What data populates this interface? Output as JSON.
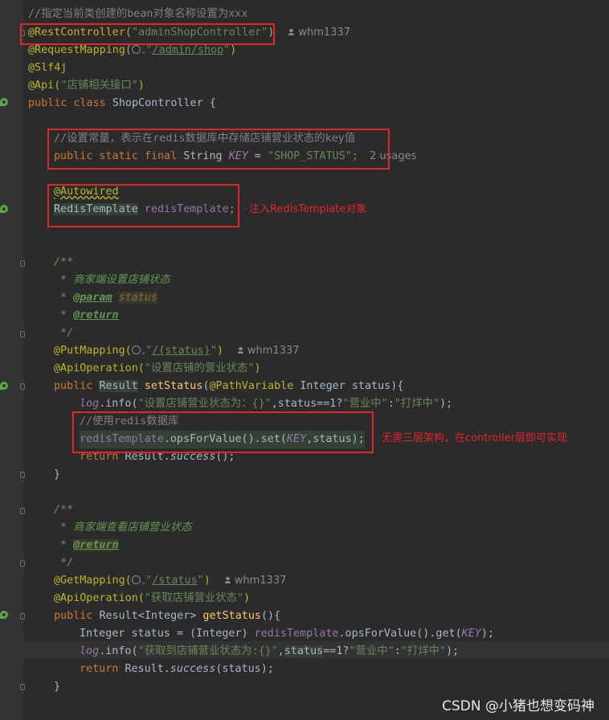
{
  "code": {
    "l1": "//指定当前类创建的bean对象名称设置为xxx",
    "l2_ann": "@RestController(",
    "l2_str": "\"adminShopController\"",
    "l2_end": ")",
    "author": "whm1337",
    "l3_ann": "@RequestMapping(",
    "l3_q1": "\"",
    "l3_path": "/admin/shop",
    "l3_q2": "\"",
    "l3_end": ")",
    "l4": "@Slf4j",
    "l5_ann": "@Api(",
    "l5_str": "\"店铺相关接口\"",
    "l5_end": ")",
    "l6_kw": "public class ",
    "l6_name": "ShopController {",
    "l8": "//设置常量，表示在redis数据库中存储店铺营业状态的key值",
    "l9_kw": "public static final ",
    "l9_type": "String ",
    "l9_field": "KEY",
    "l9_eq": " = ",
    "l9_str": "\"SHOP_STATUS\"",
    "l9_semi": ";",
    "l9_usages": "2 usages",
    "l11": "@Autowired",
    "l12_type": "RedisTemplate",
    "l12_field": " redisTemplate",
    "l12_semi": ";",
    "note1": "注入RedisTemplate对象",
    "l15": "/**",
    "l16": " * 商家端设置店铺状态",
    "l17_star": " * ",
    "l17_tag": "@param",
    "l17_param": "status",
    "l18_star": " * ",
    "l18_tag": "@return",
    "l19": " */",
    "l20_ann": "@PutMapping(",
    "l20_q1": "\"",
    "l20_path": "/{status}",
    "l20_q2": "\"",
    "l20_end": ")",
    "l21_ann": "@ApiOperation(",
    "l21_str": "\"设置店铺的营业状态\"",
    "l21_end": ")",
    "l22_kw": "public ",
    "l22_type": "Result",
    "l22_fn": " setStatus",
    "l22_p1": "(",
    "l22_ann": "@PathVariable",
    "l22_rest": " Integer status){",
    "l23_log": "log",
    "l23_a": ".info(",
    "l23_str": "\"设置店铺营业状态为：{}\"",
    "l23_b": ",status==1?",
    "l23_s2": "\"营业中\"",
    "l23_c": ":",
    "l23_s3": "\"打烊中\"",
    "l23_d": ");",
    "l24": "//使用redis数据库",
    "l25_field": "redisTemplate",
    "l25_a": ".opsForValue().set(",
    "l25_key": "KEY",
    "l25_b": ",status);",
    "note2": "无需三层架构，在controller层即可实现",
    "l26_kw": "return ",
    "l26_a": "Result.",
    "l26_m": "success",
    "l26_b": "();",
    "l27": "}",
    "l29": "/**",
    "l30": " * 商家端查看店铺营业状态",
    "l31_star": " * ",
    "l31_tag": "@return",
    "l32": " */",
    "l33_ann": "@GetMapping(",
    "l33_q1": "\"",
    "l33_path": "/status",
    "l33_q2": "\"",
    "l33_end": ")",
    "l34_ann": "@ApiOperation(",
    "l34_str": "\"获取店铺营业状态\"",
    "l34_end": ")",
    "l35_kw": "public ",
    "l35_type": "Result<Integer>",
    "l35_fn": " getStatus",
    "l35_end": "(){",
    "l36_type": "Integer status = (Integer) ",
    "l36_field": "redisTemplate",
    "l36_a": ".opsForValue().get(",
    "l36_key": "KEY",
    "l36_b": ");",
    "l37_log": "log",
    "l37_a": ".info(",
    "l37_str": "\"获取到店铺营业状态为:{}\"",
    "l37_b": ",",
    "l37_st": "status",
    "l37_c": "==1?",
    "l37_s2": "\"营业中\"",
    "l37_d": ":",
    "l37_s3": "\"打烊中\"",
    "l37_e": ");",
    "l38_kw": "return ",
    "l38_a": "Result.",
    "l38_m": "success",
    "l38_b": "(status);",
    "l39": "}"
  },
  "watermark": "CSDN @小猪也想变码神"
}
